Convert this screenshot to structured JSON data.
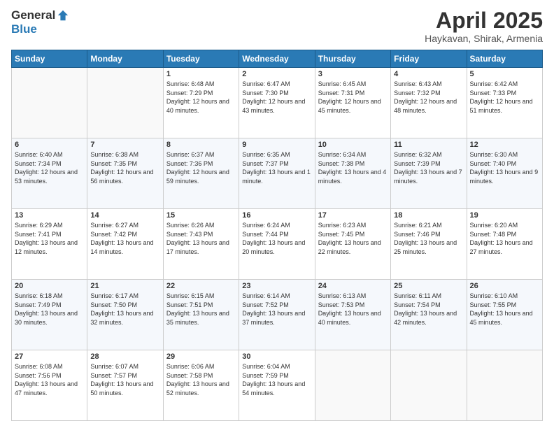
{
  "logo": {
    "general": "General",
    "blue": "Blue"
  },
  "title": "April 2025",
  "location": "Haykavan, Shirak, Armenia",
  "days_of_week": [
    "Sunday",
    "Monday",
    "Tuesday",
    "Wednesday",
    "Thursday",
    "Friday",
    "Saturday"
  ],
  "weeks": [
    [
      {
        "day": "",
        "info": ""
      },
      {
        "day": "",
        "info": ""
      },
      {
        "day": "1",
        "info": "Sunrise: 6:48 AM\nSunset: 7:29 PM\nDaylight: 12 hours\nand 40 minutes."
      },
      {
        "day": "2",
        "info": "Sunrise: 6:47 AM\nSunset: 7:30 PM\nDaylight: 12 hours\nand 43 minutes."
      },
      {
        "day": "3",
        "info": "Sunrise: 6:45 AM\nSunset: 7:31 PM\nDaylight: 12 hours\nand 45 minutes."
      },
      {
        "day": "4",
        "info": "Sunrise: 6:43 AM\nSunset: 7:32 PM\nDaylight: 12 hours\nand 48 minutes."
      },
      {
        "day": "5",
        "info": "Sunrise: 6:42 AM\nSunset: 7:33 PM\nDaylight: 12 hours\nand 51 minutes."
      }
    ],
    [
      {
        "day": "6",
        "info": "Sunrise: 6:40 AM\nSunset: 7:34 PM\nDaylight: 12 hours\nand 53 minutes."
      },
      {
        "day": "7",
        "info": "Sunrise: 6:38 AM\nSunset: 7:35 PM\nDaylight: 12 hours\nand 56 minutes."
      },
      {
        "day": "8",
        "info": "Sunrise: 6:37 AM\nSunset: 7:36 PM\nDaylight: 12 hours\nand 59 minutes."
      },
      {
        "day": "9",
        "info": "Sunrise: 6:35 AM\nSunset: 7:37 PM\nDaylight: 13 hours\nand 1 minute."
      },
      {
        "day": "10",
        "info": "Sunrise: 6:34 AM\nSunset: 7:38 PM\nDaylight: 13 hours\nand 4 minutes."
      },
      {
        "day": "11",
        "info": "Sunrise: 6:32 AM\nSunset: 7:39 PM\nDaylight: 13 hours\nand 7 minutes."
      },
      {
        "day": "12",
        "info": "Sunrise: 6:30 AM\nSunset: 7:40 PM\nDaylight: 13 hours\nand 9 minutes."
      }
    ],
    [
      {
        "day": "13",
        "info": "Sunrise: 6:29 AM\nSunset: 7:41 PM\nDaylight: 13 hours\nand 12 minutes."
      },
      {
        "day": "14",
        "info": "Sunrise: 6:27 AM\nSunset: 7:42 PM\nDaylight: 13 hours\nand 14 minutes."
      },
      {
        "day": "15",
        "info": "Sunrise: 6:26 AM\nSunset: 7:43 PM\nDaylight: 13 hours\nand 17 minutes."
      },
      {
        "day": "16",
        "info": "Sunrise: 6:24 AM\nSunset: 7:44 PM\nDaylight: 13 hours\nand 20 minutes."
      },
      {
        "day": "17",
        "info": "Sunrise: 6:23 AM\nSunset: 7:45 PM\nDaylight: 13 hours\nand 22 minutes."
      },
      {
        "day": "18",
        "info": "Sunrise: 6:21 AM\nSunset: 7:46 PM\nDaylight: 13 hours\nand 25 minutes."
      },
      {
        "day": "19",
        "info": "Sunrise: 6:20 AM\nSunset: 7:48 PM\nDaylight: 13 hours\nand 27 minutes."
      }
    ],
    [
      {
        "day": "20",
        "info": "Sunrise: 6:18 AM\nSunset: 7:49 PM\nDaylight: 13 hours\nand 30 minutes."
      },
      {
        "day": "21",
        "info": "Sunrise: 6:17 AM\nSunset: 7:50 PM\nDaylight: 13 hours\nand 32 minutes."
      },
      {
        "day": "22",
        "info": "Sunrise: 6:15 AM\nSunset: 7:51 PM\nDaylight: 13 hours\nand 35 minutes."
      },
      {
        "day": "23",
        "info": "Sunrise: 6:14 AM\nSunset: 7:52 PM\nDaylight: 13 hours\nand 37 minutes."
      },
      {
        "day": "24",
        "info": "Sunrise: 6:13 AM\nSunset: 7:53 PM\nDaylight: 13 hours\nand 40 minutes."
      },
      {
        "day": "25",
        "info": "Sunrise: 6:11 AM\nSunset: 7:54 PM\nDaylight: 13 hours\nand 42 minutes."
      },
      {
        "day": "26",
        "info": "Sunrise: 6:10 AM\nSunset: 7:55 PM\nDaylight: 13 hours\nand 45 minutes."
      }
    ],
    [
      {
        "day": "27",
        "info": "Sunrise: 6:08 AM\nSunset: 7:56 PM\nDaylight: 13 hours\nand 47 minutes."
      },
      {
        "day": "28",
        "info": "Sunrise: 6:07 AM\nSunset: 7:57 PM\nDaylight: 13 hours\nand 50 minutes."
      },
      {
        "day": "29",
        "info": "Sunrise: 6:06 AM\nSunset: 7:58 PM\nDaylight: 13 hours\nand 52 minutes."
      },
      {
        "day": "30",
        "info": "Sunrise: 6:04 AM\nSunset: 7:59 PM\nDaylight: 13 hours\nand 54 minutes."
      },
      {
        "day": "",
        "info": ""
      },
      {
        "day": "",
        "info": ""
      },
      {
        "day": "",
        "info": ""
      }
    ]
  ]
}
